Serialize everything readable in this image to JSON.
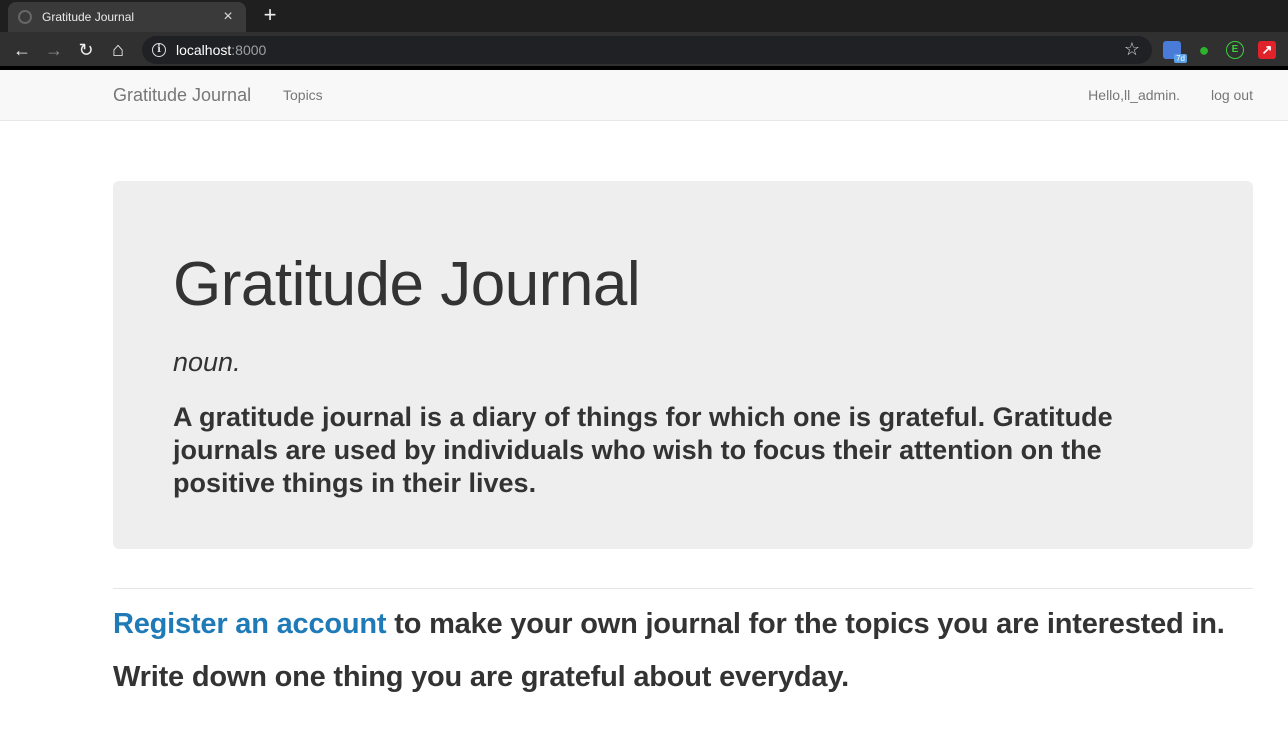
{
  "browser": {
    "tab_title": "Gratitude Journal",
    "close_glyph": "×",
    "newtab_glyph": "+",
    "back_glyph": "←",
    "forward_glyph": "→",
    "reload_glyph": "↻",
    "home_glyph": "⌂",
    "url_host": "localhost",
    "url_port": ":8000",
    "star_glyph": "☆",
    "ext_badge": "7d",
    "ext_e_label": "E"
  },
  "navbar": {
    "brand": "Gratitude Journal",
    "topics": "Topics",
    "greeting": "Hello,ll_admin.",
    "logout": "log out"
  },
  "jumbotron": {
    "title": "Gratitude Journal",
    "part_of_speech": "noun.",
    "definition": "A gratitude journal is a diary of things for which one is grateful. Gratitude journals are used by individuals who wish to focus their attention on the positive things in their lives."
  },
  "content": {
    "register_link": "Register an account",
    "register_rest": " to make your own journal for the topics you are interested in.",
    "write_line": "Write down one thing you are grateful about everyday."
  },
  "colors": {
    "link": "#1f7ab8",
    "jumbotron_bg": "#eeeeee",
    "navbar_bg": "#f8f8f8"
  }
}
